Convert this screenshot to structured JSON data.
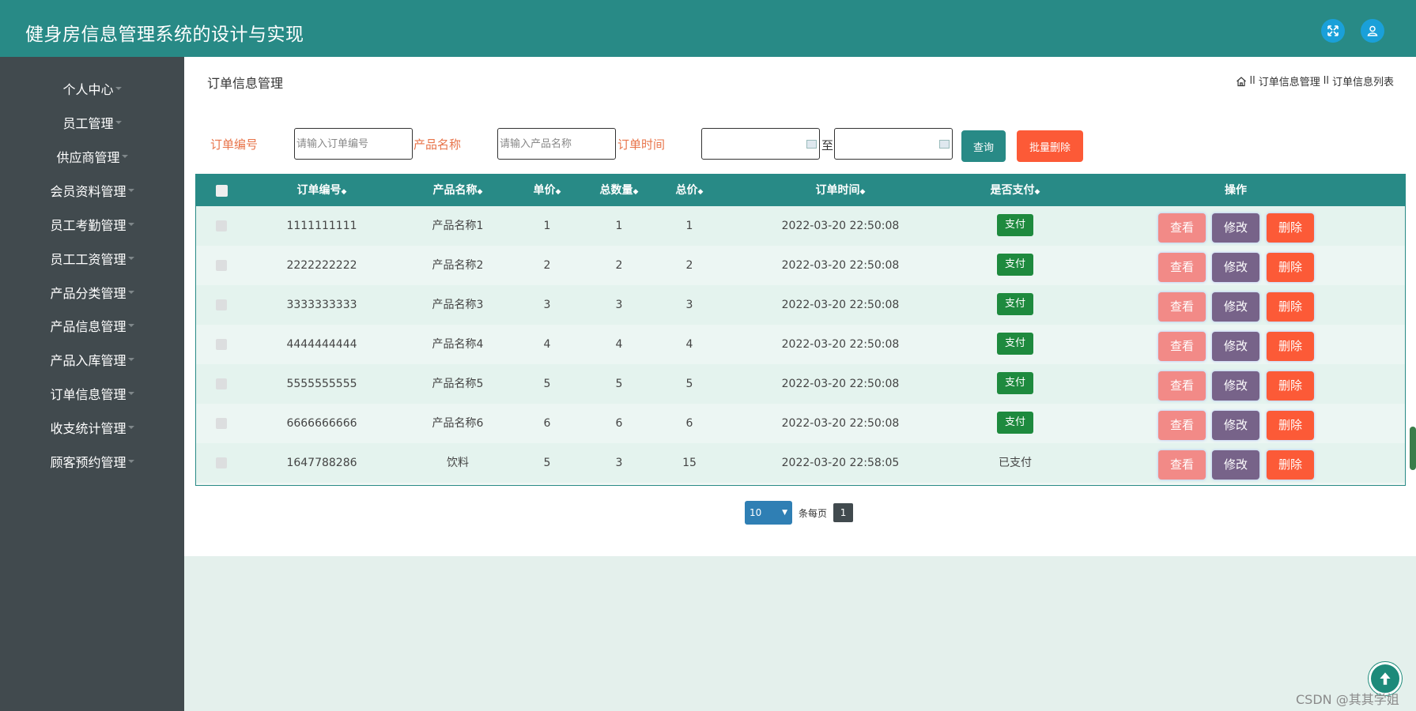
{
  "header": {
    "title": "健身房信息管理系统的设计与实现",
    "fullscreen_icon": "fullscreen-icon",
    "user_icon": "user-icon"
  },
  "sidebar": {
    "items": [
      {
        "label": "个人中心"
      },
      {
        "label": "员工管理"
      },
      {
        "label": "供应商管理"
      },
      {
        "label": "会员资料管理"
      },
      {
        "label": "员工考勤管理"
      },
      {
        "label": "员工工资管理"
      },
      {
        "label": "产品分类管理"
      },
      {
        "label": "产品信息管理"
      },
      {
        "label": "产品入库管理"
      },
      {
        "label": "订单信息管理"
      },
      {
        "label": "收支统计管理"
      },
      {
        "label": "顾客预约管理"
      }
    ]
  },
  "page": {
    "title": "订单信息管理",
    "breadcrumb": {
      "home_icon": "home-icon",
      "sep1": "ll",
      "item1": "订单信息管理",
      "sep2": "ll",
      "item2": "订单信息列表"
    }
  },
  "search": {
    "order_no_label": "订单编号",
    "order_no_placeholder": "请输入订单编号",
    "product_label": "产品名称",
    "product_placeholder": "请输入产品名称",
    "time_label": "订单时间",
    "to_label": "至",
    "query_button": "查询",
    "batch_delete_button": "批量删除"
  },
  "table": {
    "headers": {
      "order_no": "订单编号",
      "product": "产品名称",
      "unit_price": "单价",
      "quantity": "总数量",
      "total": "总价",
      "time": "订单时间",
      "paid": "是否支付",
      "ops": "操作"
    },
    "sort_glyph": "◆",
    "actions": {
      "view": "查看",
      "edit": "修改",
      "delete": "删除"
    },
    "rows": [
      {
        "order_no": "1111111111",
        "product": "产品名称1",
        "unit_price": "1",
        "quantity": "1",
        "total": "1",
        "time": "2022-03-20 22:50:08",
        "paid": "支付"
      },
      {
        "order_no": "2222222222",
        "product": "产品名称2",
        "unit_price": "2",
        "quantity": "2",
        "total": "2",
        "time": "2022-03-20 22:50:08",
        "paid": "支付"
      },
      {
        "order_no": "3333333333",
        "product": "产品名称3",
        "unit_price": "3",
        "quantity": "3",
        "total": "3",
        "time": "2022-03-20 22:50:08",
        "paid": "支付"
      },
      {
        "order_no": "4444444444",
        "product": "产品名称4",
        "unit_price": "4",
        "quantity": "4",
        "total": "4",
        "time": "2022-03-20 22:50:08",
        "paid": "支付"
      },
      {
        "order_no": "5555555555",
        "product": "产品名称5",
        "unit_price": "5",
        "quantity": "5",
        "total": "5",
        "time": "2022-03-20 22:50:08",
        "paid": "支付"
      },
      {
        "order_no": "6666666666",
        "product": "产品名称6",
        "unit_price": "6",
        "quantity": "6",
        "total": "6",
        "time": "2022-03-20 22:50:08",
        "paid": "支付"
      },
      {
        "order_no": "1647788286",
        "product": "饮料",
        "unit_price": "5",
        "quantity": "3",
        "total": "15",
        "time": "2022-03-20 22:58:05",
        "paid": "已支付"
      }
    ]
  },
  "pager": {
    "page_size": "10",
    "per_page_label": "条每页",
    "current_page": "1"
  },
  "watermark": "CSDN @其其学姐",
  "colors": {
    "header": "#288a86",
    "sidebar": "#414a4e",
    "label_orange": "#e8744a",
    "query": "#288a86",
    "batch_delete": "#fc5a37",
    "paid_green": "#1e8a3e",
    "view": "#f28a87",
    "edit": "#776389",
    "delete": "#fc5a37"
  }
}
